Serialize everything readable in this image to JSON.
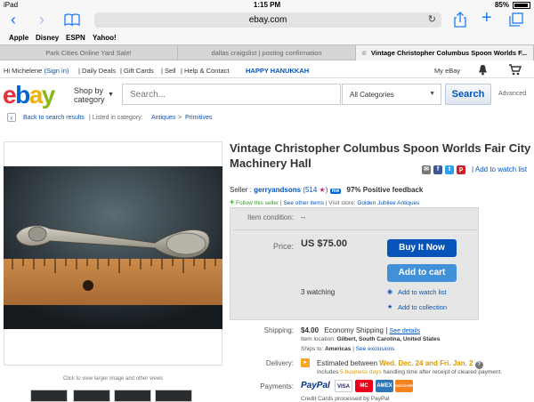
{
  "status_bar": {
    "device": "iPad",
    "time": "1:15 PM",
    "battery": "85%"
  },
  "browser": {
    "url": "ebay.com",
    "bookmarks": [
      "Apple",
      "Disney",
      "ESPN",
      "Yahoo!"
    ],
    "tabs": [
      {
        "label": "Park Cities Online Yard Sale!"
      },
      {
        "label": "dallas craigslist | posting confirmation"
      },
      {
        "label": "Vintage Christopher Columbus Spoon Worlds F..."
      }
    ]
  },
  "topnav": {
    "greeting": "Hi Michelene",
    "sign_in": "(Sign in)",
    "items": [
      "Daily Deals",
      "Gift Cards",
      "Sell",
      "Help & Contact"
    ],
    "promo": "HAPPY HANUKKAH",
    "my_ebay": "My eBay"
  },
  "header": {
    "shop_by": "Shop by category",
    "search_placeholder": "Search...",
    "category_select": "All Categories",
    "search_button": "Search",
    "advanced": "Advanced"
  },
  "breadcrumb": {
    "back": "Back to search results",
    "listed_in": "| Listed in category:",
    "cat1": "Antiques",
    "sep": ">",
    "cat2": "Primitives"
  },
  "item": {
    "title": "Vintage Christopher Columbus Spoon Worlds Fair City Machinery Hall",
    "add_to_watch_list": "Add to watch list",
    "image_caption": "Click to view larger image and other views",
    "seller_label": "Seller :",
    "seller_name": "gerryandsons",
    "seller_score": "(514",
    "seller_score_close": ")",
    "seller_badge": "me",
    "positive_feedback": "97% Positive feedback",
    "follow": "Follow this seller",
    "see_other": "See other items",
    "visit_store_label": "Visit store:",
    "store_name": "Golden Jubilee Antiques",
    "condition_label": "Item condition:",
    "condition_value": "--",
    "price_label": "Price:",
    "price": "US $75.00",
    "buy_now": "Buy It Now",
    "add_to_cart": "Add to cart",
    "watching": "3 watching",
    "watch_link": "Add to watch list",
    "collection_link": "Add to collection"
  },
  "shipping": {
    "label": "Shipping:",
    "cost": "$4.00",
    "method": "Economy Shipping",
    "see_details": "See details",
    "item_location_label": "Item location:",
    "item_location": "Gilbert, South Carolina, United States",
    "ships_to_label": "Ships to:",
    "ships_to": "Americas",
    "see_exclusions": "See exclusions"
  },
  "delivery": {
    "label": "Delivery:",
    "estimated": "Estimated between",
    "dates": "Wed. Dec. 24 and Fri. Jan. 2",
    "includes": "Includes",
    "business_days": "5 business days",
    "handling": "handling time after receipt of cleared payment."
  },
  "payments": {
    "label": "Payments:",
    "paypal": "PayPal",
    "cards": [
      "VISA",
      "MC",
      "AMEX",
      "DISCOVER"
    ],
    "note": "Credit Cards processed by PayPal"
  },
  "colors": {
    "ebay_red": "#e53238",
    "ebay_blue": "#0064d2",
    "ebay_yellow": "#f5af02",
    "ebay_green": "#86b817",
    "link": "#0654ba",
    "buy_now": "#0654ba",
    "add_to_cart": "#4191d9",
    "delivery_dates": "#dd9900"
  }
}
